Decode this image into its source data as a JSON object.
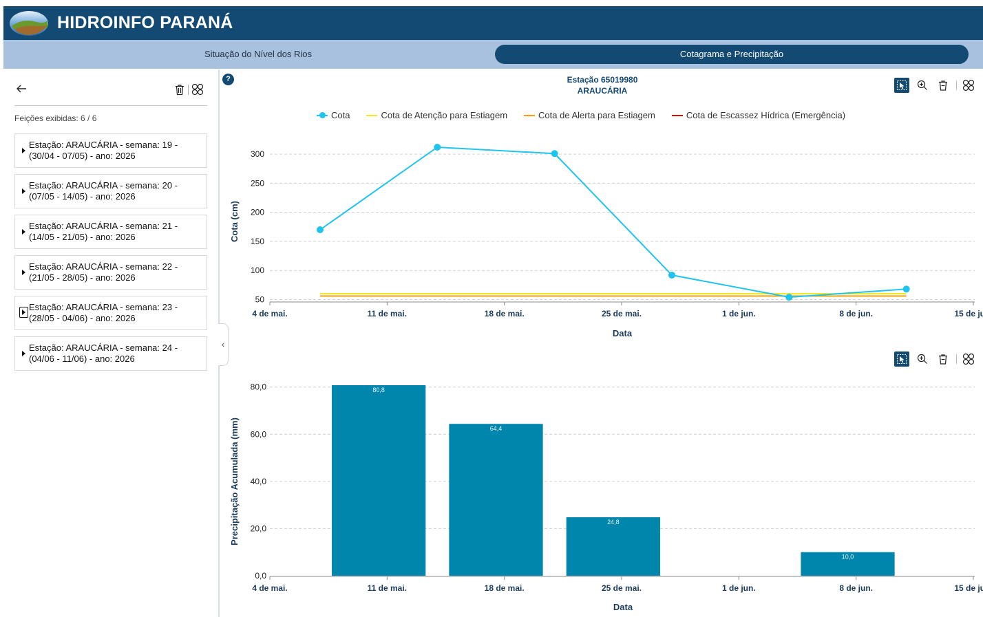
{
  "app": {
    "title": "HIDROINFO PARANÁ"
  },
  "tabs": [
    {
      "label": "Situação do Nível dos Rios"
    },
    {
      "label": "Cotagrama e Precipitação"
    }
  ],
  "sidebar": {
    "count_label": "Feições exibidas: 6 / 6",
    "items": [
      {
        "line1": "Estação: ARAUCÁRIA - semana: 19 -",
        "line2": "(30/04 - 07/05) - ano: 2026"
      },
      {
        "line1": "Estação: ARAUCÁRIA - semana: 20 -",
        "line2": "(07/05 - 14/05) - ano: 2026"
      },
      {
        "line1": "Estação: ARAUCÁRIA - semana: 21 -",
        "line2": "(14/05 - 21/05) - ano: 2026"
      },
      {
        "line1": "Estação: ARAUCÁRIA - semana: 22 -",
        "line2": "(21/05 - 28/05) - ano: 2026"
      },
      {
        "line1": "Estação: ARAUCÁRIA - semana: 23 -",
        "line2": "(28/05 - 04/06) - ano: 2026"
      },
      {
        "line1": "Estação: ARAUCÁRIA - semana: 24 -",
        "line2": "(04/06 - 11/06) - ano: 2026"
      }
    ]
  },
  "help": {
    "label": "?"
  },
  "station": {
    "line1": "Estação 65019980",
    "line2": "ARAUCÁRIA"
  },
  "colors": {
    "brand": "#134a73",
    "tabbar": "#a8c1de",
    "cota": "#1ec3ee",
    "atencao": "#f2e82b",
    "alerta": "#f5a30a",
    "escassez": "#d40c0c",
    "bars": "#0086ad"
  },
  "icons": [
    "back-arrow-icon",
    "trash-icon",
    "grid-icon",
    "select-cursor-icon",
    "zoom-in-icon",
    "clear-icon",
    "collapse-chevron-icon",
    "help-icon"
  ],
  "chart_data": [
    {
      "type": "line",
      "xlabel": "Data",
      "ylabel": "Cota (cm)",
      "x_ticks": [
        "4 de mai.",
        "11 de mai.",
        "18 de mai.",
        "25 de mai.",
        "1 de jun.",
        "8 de jun.",
        "15 de jun."
      ],
      "y_ticks": [
        "50",
        "100",
        "150",
        "200",
        "250",
        "300"
      ],
      "ylim": [
        47,
        325
      ],
      "legend_position": "top",
      "grid": true,
      "series": [
        {
          "name": "Cota",
          "color": "#1ec3ee",
          "x": [
            "2026-05-07",
            "2026-05-14",
            "2026-05-21",
            "2026-05-28",
            "2026-06-04",
            "2026-06-11"
          ],
          "y": [
            170,
            312,
            301,
            92,
            54,
            68
          ]
        },
        {
          "name": "Cota de Atenção para Estiagem",
          "color": "#f2e82b",
          "x": [
            "2026-05-07",
            "2026-06-11"
          ],
          "y": [
            60,
            60
          ]
        },
        {
          "name": "Cota de Alerta para Estiagem",
          "color": "#f5a30a",
          "x": [
            "2026-05-07",
            "2026-06-11"
          ],
          "y": [
            56,
            56
          ]
        },
        {
          "name": "Cota de Escassez Hídrica (Emergência)",
          "color": "#d40c0c",
          "x": [],
          "y": []
        }
      ]
    },
    {
      "type": "bar",
      "xlabel": "Data",
      "ylabel": "Precipitação Acumulada (mm)",
      "x_ticks": [
        "4 de mai.",
        "11 de mai.",
        "18 de mai.",
        "25 de mai.",
        "1 de jun.",
        "8 de jun.",
        "15 de jun."
      ],
      "y_ticks": [
        "0,0",
        "20,0",
        "40,0",
        "60,0",
        "80,0"
      ],
      "ylim": [
        0,
        80.8
      ],
      "grid": true,
      "bars": [
        {
          "x": "2026-05-14",
          "value": 80.8,
          "label": "80,8"
        },
        {
          "x": "2026-05-21",
          "value": 64.4,
          "label": "64,4"
        },
        {
          "x": "2026-05-28",
          "value": 24.8,
          "label": "24,8"
        },
        {
          "x": "2026-06-11",
          "value": 10.0,
          "label": "10,0"
        }
      ]
    }
  ]
}
